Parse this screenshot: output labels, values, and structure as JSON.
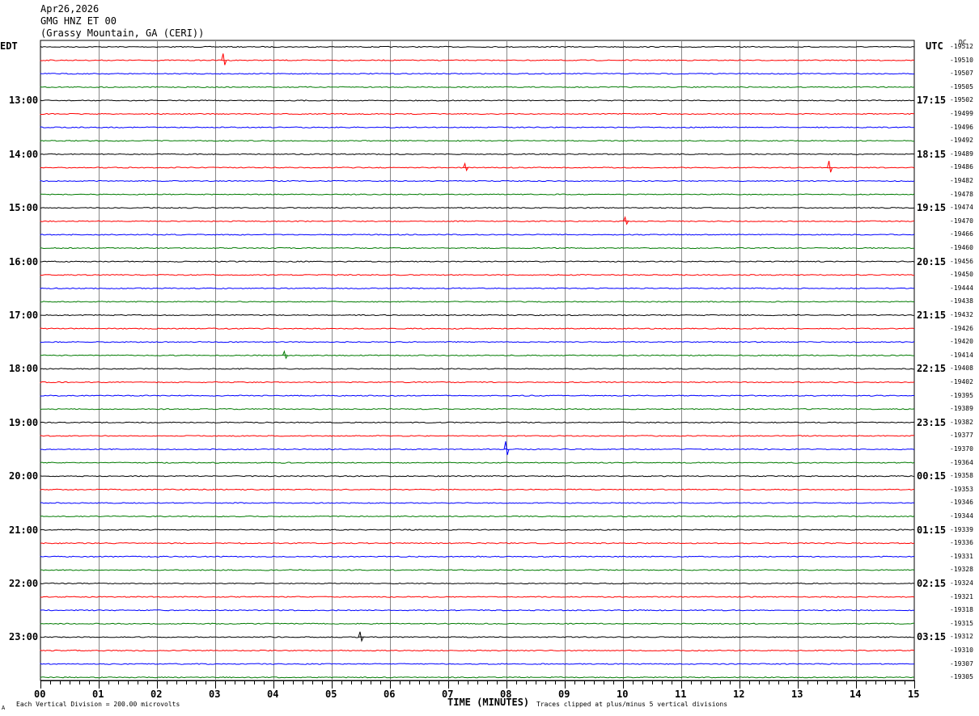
{
  "header": {
    "date": "Apr26,2026",
    "station": "GMG HNZ ET 00",
    "location": "(Grassy Mountain, GA (CERI))"
  },
  "left_zone": "EDT",
  "right_zone": "UTC",
  "dc_label": "DC",
  "footer": {
    "scale_note": "Each Vertical Division =  200.00 microvolts",
    "clip_note": "Traces clipped at plus/minus 5 vertical divisions",
    "corner_mark": "A"
  },
  "colors": {
    "black": "#000000",
    "red": "#ff0000",
    "blue": "#0000ff",
    "green": "#007a00",
    "grid": "#888888"
  },
  "chart_data": {
    "type": "line",
    "title": "GMG HNZ ET 00",
    "xlabel": "TIME (MINUTES)",
    "ylabel": "",
    "x_ticks": [
      "00",
      "01",
      "02",
      "03",
      "04",
      "05",
      "06",
      "07",
      "08",
      "09",
      "10",
      "11",
      "12",
      "13",
      "14",
      "15"
    ],
    "xlim": [
      0,
      15
    ],
    "trace_colors": [
      "black",
      "red",
      "blue",
      "green"
    ],
    "left_hour_labels": [
      "13:00",
      "14:00",
      "15:00",
      "16:00",
      "17:00",
      "18:00",
      "19:00",
      "20:00",
      "21:00",
      "22:00",
      "23:00"
    ],
    "right_hour_labels": [
      "17:15",
      "18:15",
      "19:15",
      "20:15",
      "21:15",
      "22:15",
      "23:15",
      "00:15",
      "01:15",
      "02:15",
      "03:15"
    ],
    "dc_offsets": [
      "-19512",
      "-19510",
      "-19507",
      "-19505",
      "-19502",
      "-19499",
      "-19496",
      "-19492",
      "-19489",
      "-19486",
      "-19482",
      "-19478",
      "-19474",
      "-19470",
      "-19466",
      "-19460",
      "-19456",
      "-19450",
      "-19444",
      "-19438",
      "-19432",
      "-19426",
      "-19420",
      "-19414",
      "-19408",
      "-19402",
      "-19395",
      "-19389",
      "-19382",
      "-19377",
      "-19370",
      "-19364",
      "-19358",
      "-19353",
      "-19346",
      "-19344",
      "-19339",
      "-19336",
      "-19331",
      "-19328",
      "-19324",
      "-19321",
      "-19318",
      "-19315",
      "-19312",
      "-19310",
      "-19307",
      "-19305"
    ],
    "events": [
      {
        "trace": 1,
        "minute": 3.15,
        "amplitude": 0.5
      },
      {
        "trace": 9,
        "minute": 7.3,
        "amplitude": 0.3
      },
      {
        "trace": 9,
        "minute": 13.55,
        "amplitude": 0.5
      },
      {
        "trace": 13,
        "minute": 10.05,
        "amplitude": 0.3
      },
      {
        "trace": 23,
        "minute": 4.2,
        "amplitude": 0.3
      },
      {
        "trace": 30,
        "minute": 8.0,
        "amplitude": 0.6
      },
      {
        "trace": 44,
        "minute": 5.5,
        "amplitude": 0.4
      }
    ]
  }
}
